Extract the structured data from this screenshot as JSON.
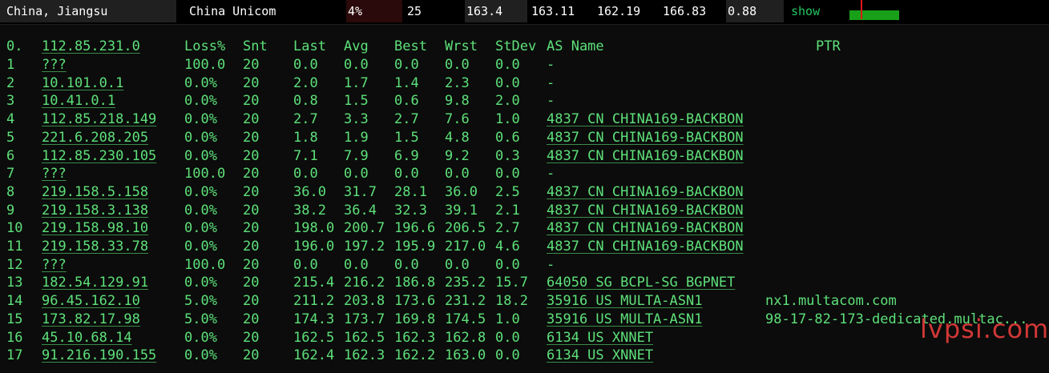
{
  "summary": {
    "region": "China, Jiangsu",
    "isp": "China Unicom",
    "loss": "4%",
    "snt": "25",
    "last": "163.4",
    "avg": "163.11",
    "best": "162.19",
    "wrst": "166.83",
    "stdev": "0.88",
    "show_label": "show"
  },
  "colors": {
    "accent_green": "#5ee07a",
    "graph_green": "#18a018",
    "graph_marker": "#e01818",
    "watermark_red": "#e23b3b"
  },
  "table": {
    "headers": {
      "num": "0.",
      "host": "112.85.231.0",
      "loss": "Loss%",
      "snt": "Snt",
      "last": "Last",
      "avg": "Avg",
      "best": "Best",
      "wrst": "Wrst",
      "stdev": "StDev",
      "as": "AS Name",
      "ptr": "PTR"
    },
    "rows": [
      {
        "num": "1",
        "host": "???",
        "loss": "100.0",
        "snt": "20",
        "last": "0.0",
        "avg": "0.0",
        "best": "0.0",
        "wrst": "0.0",
        "stdev": "0.0",
        "as": "-",
        "ptr": ""
      },
      {
        "num": "2",
        "host": "10.101.0.1",
        "loss": "0.0%",
        "snt": "20",
        "last": "2.0",
        "avg": "1.7",
        "best": "1.4",
        "wrst": "2.3",
        "stdev": "0.0",
        "as": "-",
        "ptr": ""
      },
      {
        "num": "3",
        "host": "10.41.0.1",
        "loss": "0.0%",
        "snt": "20",
        "last": "0.8",
        "avg": "1.5",
        "best": "0.6",
        "wrst": "9.8",
        "stdev": "2.0",
        "as": "-",
        "ptr": ""
      },
      {
        "num": "4",
        "host": "112.85.218.149",
        "loss": "0.0%",
        "snt": "20",
        "last": "2.7",
        "avg": "3.3",
        "best": "2.7",
        "wrst": "7.6",
        "stdev": "1.0",
        "as": "4837  CN CHINA169-BACKBON",
        "ptr": ""
      },
      {
        "num": "5",
        "host": "221.6.208.205",
        "loss": "0.0%",
        "snt": "20",
        "last": "1.8",
        "avg": "1.9",
        "best": "1.5",
        "wrst": "4.8",
        "stdev": "0.6",
        "as": "4837  CN CHINA169-BACKBON",
        "ptr": ""
      },
      {
        "num": "6",
        "host": "112.85.230.105",
        "loss": "0.0%",
        "snt": "20",
        "last": "7.1",
        "avg": "7.9",
        "best": "6.9",
        "wrst": "9.2",
        "stdev": "0.3",
        "as": "4837  CN CHINA169-BACKBON",
        "ptr": ""
      },
      {
        "num": "7",
        "host": "???",
        "loss": "100.0",
        "snt": "20",
        "last": "0.0",
        "avg": "0.0",
        "best": "0.0",
        "wrst": "0.0",
        "stdev": "0.0",
        "as": "-",
        "ptr": ""
      },
      {
        "num": "8",
        "host": "219.158.5.158",
        "loss": "0.0%",
        "snt": "20",
        "last": "36.0",
        "avg": "31.7",
        "best": "28.1",
        "wrst": "36.0",
        "stdev": "2.5",
        "as": "4837  CN CHINA169-BACKBON",
        "ptr": ""
      },
      {
        "num": "9",
        "host": "219.158.3.138",
        "loss": "0.0%",
        "snt": "20",
        "last": "38.2",
        "avg": "36.4",
        "best": "32.3",
        "wrst": "39.1",
        "stdev": "2.1",
        "as": "4837  CN CHINA169-BACKBON",
        "ptr": ""
      },
      {
        "num": "10",
        "host": "219.158.98.10",
        "loss": "0.0%",
        "snt": "20",
        "last": "198.0",
        "avg": "200.7",
        "best": "196.6",
        "wrst": "206.5",
        "stdev": "2.7",
        "as": "4837  CN CHINA169-BACKBON",
        "ptr": ""
      },
      {
        "num": "11",
        "host": "219.158.33.78",
        "loss": "0.0%",
        "snt": "20",
        "last": "196.0",
        "avg": "197.2",
        "best": "195.9",
        "wrst": "217.0",
        "stdev": "4.6",
        "as": "4837  CN CHINA169-BACKBON",
        "ptr": ""
      },
      {
        "num": "12",
        "host": "???",
        "loss": "100.0",
        "snt": "20",
        "last": "0.0",
        "avg": "0.0",
        "best": "0.0",
        "wrst": "0.0",
        "stdev": "0.0",
        "as": "-",
        "ptr": ""
      },
      {
        "num": "13",
        "host": "182.54.129.91",
        "loss": "0.0%",
        "snt": "20",
        "last": "215.4",
        "avg": "216.2",
        "best": "186.8",
        "wrst": "235.2",
        "stdev": "15.7",
        "as": "64050 SG BCPL-SG BGPNET",
        "ptr": ""
      },
      {
        "num": "14",
        "host": "96.45.162.10",
        "loss": "5.0%",
        "snt": "20",
        "last": "211.2",
        "avg": "203.8",
        "best": "173.6",
        "wrst": "231.2",
        "stdev": "18.2",
        "as": "35916 US MULTA-ASN1",
        "ptr": "nx1.multacom.com"
      },
      {
        "num": "15",
        "host": "173.82.17.98",
        "loss": "5.0%",
        "snt": "20",
        "last": "174.3",
        "avg": "173.7",
        "best": "169.8",
        "wrst": "174.5",
        "stdev": "1.0",
        "as": "35916 US MULTA-ASN1",
        "ptr": "98-17-82-173-dedicated.multac..."
      },
      {
        "num": "16",
        "host": "45.10.68.14",
        "loss": "0.0%",
        "snt": "20",
        "last": "162.5",
        "avg": "162.5",
        "best": "162.3",
        "wrst": "162.8",
        "stdev": "0.0",
        "as": "6134  US XNNET",
        "ptr": ""
      },
      {
        "num": "17",
        "host": "91.216.190.155",
        "loss": "0.0%",
        "snt": "20",
        "last": "162.4",
        "avg": "162.3",
        "best": "162.2",
        "wrst": "163.0",
        "stdev": "0.0",
        "as": "6134  US XNNET",
        "ptr": ""
      }
    ]
  },
  "watermark": "lvpsi.com"
}
